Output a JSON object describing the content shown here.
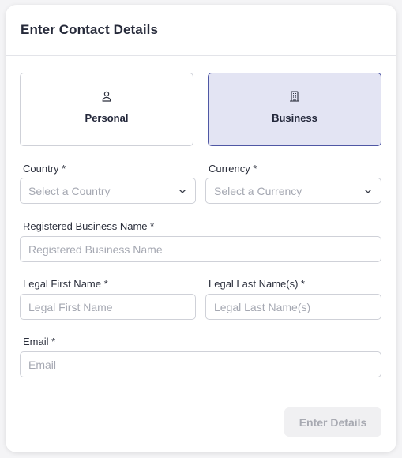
{
  "header": {
    "title": "Enter Contact Details"
  },
  "type_selector": {
    "options": [
      {
        "label": "Personal",
        "icon": "person-icon",
        "selected": false
      },
      {
        "label": "Business",
        "icon": "building-icon",
        "selected": true
      }
    ]
  },
  "form": {
    "country": {
      "label": "Country *",
      "placeholder": "Select a Country"
    },
    "currency": {
      "label": "Currency *",
      "placeholder": "Select a Currency"
    },
    "business_name": {
      "label": "Registered Business Name *",
      "placeholder": "Registered Business Name"
    },
    "first_name": {
      "label": "Legal First Name *",
      "placeholder": "Legal First Name"
    },
    "last_name": {
      "label": "Legal Last Name(s) *",
      "placeholder": "Legal Last Name(s)"
    },
    "email": {
      "label": "Email *",
      "placeholder": "Email"
    }
  },
  "actions": {
    "submit_label": "Enter Details",
    "submit_disabled": true
  },
  "colors": {
    "accent": "#4f57a4",
    "selected_bg": "#e3e4f3",
    "border": "#cfd1d8",
    "placeholder": "#a5a8b2",
    "disabled_button_bg": "#f0f0f2"
  }
}
